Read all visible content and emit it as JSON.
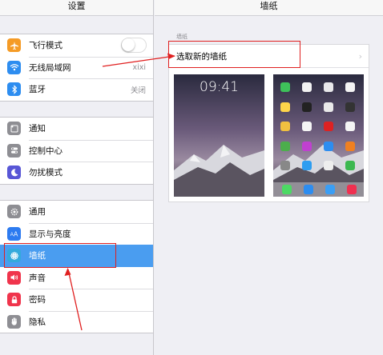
{
  "left_pane": {
    "title": "设置",
    "group1": [
      {
        "label": "飞行模式",
        "icon": "airplane-icon",
        "color": "#f59b26",
        "toggle": false
      },
      {
        "label": "无线局域网",
        "icon": "wifi-icon",
        "color": "#2d8df0",
        "value": "xixi"
      },
      {
        "label": "蓝牙",
        "icon": "bluetooth-icon",
        "color": "#2d8df0",
        "value": "关闭"
      }
    ],
    "group2": [
      {
        "label": "通知",
        "icon": "notification-icon",
        "color": "#8e8e93"
      },
      {
        "label": "控制中心",
        "icon": "control-center-icon",
        "color": "#8e8e93"
      },
      {
        "label": "勿扰模式",
        "icon": "moon-icon",
        "color": "#5856d6"
      }
    ],
    "group3": [
      {
        "label": "通用",
        "icon": "gear-icon",
        "color": "#8e8e93"
      },
      {
        "label": "显示与亮度",
        "icon": "display-brightness-icon",
        "color": "#2d7bf0"
      },
      {
        "label": "墙纸",
        "icon": "wallpaper-flower-icon",
        "color": "#34aadc",
        "selected": true
      },
      {
        "label": "声音",
        "icon": "speaker-icon",
        "color": "#f0344c"
      },
      {
        "label": "密码",
        "icon": "lock-icon",
        "color": "#f0344c"
      },
      {
        "label": "隐私",
        "icon": "hand-icon",
        "color": "#8e8e93"
      }
    ]
  },
  "right_pane": {
    "title": "墙纸",
    "section_header": "墙纸",
    "choose_label": "选取新的墙纸",
    "lock_screen_time": "09:41"
  },
  "colors": {
    "selection": "#4a9df0",
    "annotation": "#e02020"
  }
}
